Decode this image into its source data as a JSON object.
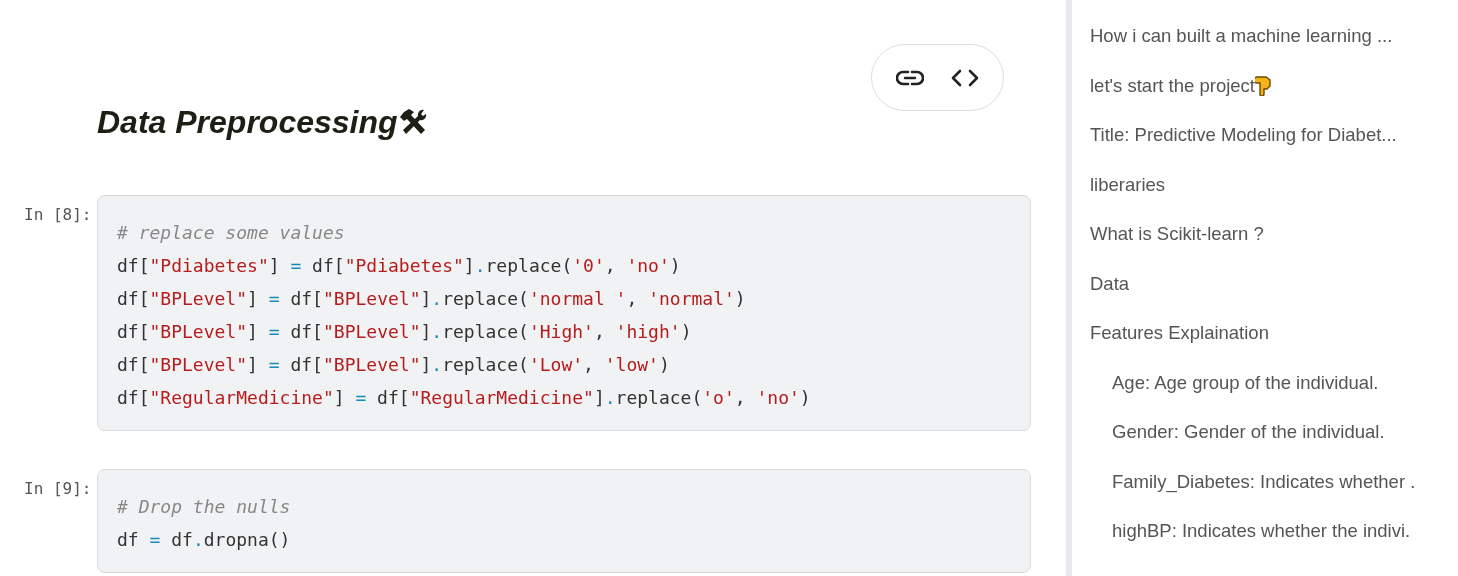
{
  "heading": {
    "text": "Data Preprocessing"
  },
  "cell_toolbar": {
    "buttons": [
      {
        "kind": "link"
      },
      {
        "kind": "code"
      }
    ]
  },
  "cells": [
    {
      "prompt": "In [8]:",
      "lines": [
        [
          {
            "kind": "comment",
            "text": "# replace some values"
          }
        ],
        [
          {
            "kind": "plain",
            "text": "df["
          },
          {
            "kind": "string",
            "text": "\"Pdiabetes\""
          },
          {
            "kind": "plain",
            "text": "] "
          },
          {
            "kind": "op",
            "text": "="
          },
          {
            "kind": "plain",
            "text": " df["
          },
          {
            "kind": "string",
            "text": "\"Pdiabetes\""
          },
          {
            "kind": "plain",
            "text": "]"
          },
          {
            "kind": "op",
            "text": "."
          },
          {
            "kind": "plain",
            "text": "replace("
          },
          {
            "kind": "string",
            "text": "'0'"
          },
          {
            "kind": "plain",
            "text": ", "
          },
          {
            "kind": "string",
            "text": "'no'"
          },
          {
            "kind": "plain",
            "text": ")"
          }
        ],
        [
          {
            "kind": "plain",
            "text": "df["
          },
          {
            "kind": "string",
            "text": "\"BPLevel\""
          },
          {
            "kind": "plain",
            "text": "] "
          },
          {
            "kind": "op",
            "text": "="
          },
          {
            "kind": "plain",
            "text": " df["
          },
          {
            "kind": "string",
            "text": "\"BPLevel\""
          },
          {
            "kind": "plain",
            "text": "]"
          },
          {
            "kind": "op",
            "text": "."
          },
          {
            "kind": "plain",
            "text": "replace("
          },
          {
            "kind": "string",
            "text": "'normal '"
          },
          {
            "kind": "plain",
            "text": ", "
          },
          {
            "kind": "string",
            "text": "'normal'"
          },
          {
            "kind": "plain",
            "text": ")"
          }
        ],
        [
          {
            "kind": "plain",
            "text": "df["
          },
          {
            "kind": "string",
            "text": "\"BPLevel\""
          },
          {
            "kind": "plain",
            "text": "] "
          },
          {
            "kind": "op",
            "text": "="
          },
          {
            "kind": "plain",
            "text": " df["
          },
          {
            "kind": "string",
            "text": "\"BPLevel\""
          },
          {
            "kind": "plain",
            "text": "]"
          },
          {
            "kind": "op",
            "text": "."
          },
          {
            "kind": "plain",
            "text": "replace("
          },
          {
            "kind": "string",
            "text": "'High'"
          },
          {
            "kind": "plain",
            "text": ", "
          },
          {
            "kind": "string",
            "text": "'high'"
          },
          {
            "kind": "plain",
            "text": ")"
          }
        ],
        [
          {
            "kind": "plain",
            "text": "df["
          },
          {
            "kind": "string",
            "text": "\"BPLevel\""
          },
          {
            "kind": "plain",
            "text": "] "
          },
          {
            "kind": "op",
            "text": "="
          },
          {
            "kind": "plain",
            "text": " df["
          },
          {
            "kind": "string",
            "text": "\"BPLevel\""
          },
          {
            "kind": "plain",
            "text": "]"
          },
          {
            "kind": "op",
            "text": "."
          },
          {
            "kind": "plain",
            "text": "replace("
          },
          {
            "kind": "string",
            "text": "'Low'"
          },
          {
            "kind": "plain",
            "text": ", "
          },
          {
            "kind": "string",
            "text": "'low'"
          },
          {
            "kind": "plain",
            "text": ")"
          }
        ],
        [
          {
            "kind": "plain",
            "text": "df["
          },
          {
            "kind": "string",
            "text": "\"RegularMedicine\""
          },
          {
            "kind": "plain",
            "text": "] "
          },
          {
            "kind": "op",
            "text": "="
          },
          {
            "kind": "plain",
            "text": " df["
          },
          {
            "kind": "string",
            "text": "\"RegularMedicine\""
          },
          {
            "kind": "plain",
            "text": "]"
          },
          {
            "kind": "op",
            "text": "."
          },
          {
            "kind": "plain",
            "text": "replace("
          },
          {
            "kind": "string",
            "text": "'o'"
          },
          {
            "kind": "plain",
            "text": ", "
          },
          {
            "kind": "string",
            "text": "'no'"
          },
          {
            "kind": "plain",
            "text": ")"
          }
        ]
      ]
    },
    {
      "prompt": "In [9]:",
      "lines": [
        [
          {
            "kind": "comment",
            "text": "# Drop the nulls"
          }
        ],
        [
          {
            "kind": "plain",
            "text": "df "
          },
          {
            "kind": "op",
            "text": "="
          },
          {
            "kind": "plain",
            "text": " df"
          },
          {
            "kind": "op",
            "text": "."
          },
          {
            "kind": "plain",
            "text": "dropna()"
          }
        ]
      ]
    }
  ],
  "outline": {
    "items": [
      {
        "label": "How i can built a machine learning ..."
      },
      {
        "label": "let's start the project",
        "kind": "pointer"
      },
      {
        "label": "Title: Predictive Modeling for Diabet..."
      },
      {
        "label": "liberaries"
      },
      {
        "label": "What is Scikit-learn ?"
      },
      {
        "label": "Data"
      },
      {
        "label": "Features Explaination",
        "children": [
          {
            "label": "Age: Age group of the individual."
          },
          {
            "label": "Gender: Gender of the individual."
          },
          {
            "label": "Family_Diabetes: Indicates whether ."
          },
          {
            "label": "highBP: Indicates whether the indivi."
          }
        ]
      }
    ]
  }
}
